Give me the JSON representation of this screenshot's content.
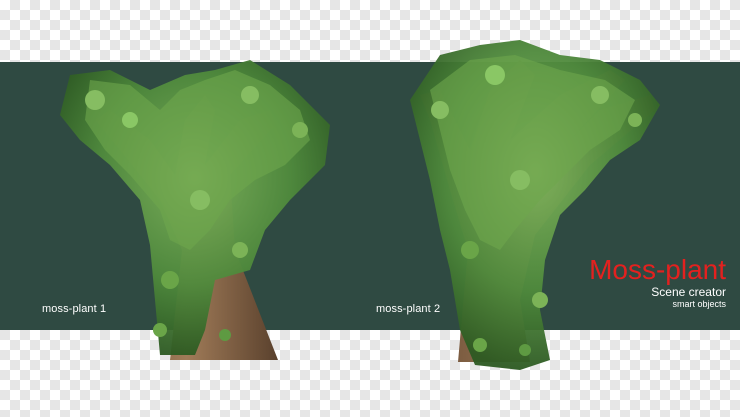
{
  "labels": {
    "plant_1": "moss-plant 1",
    "plant_2": "moss-plant 2"
  },
  "title_block": {
    "title": "Moss-plant",
    "subtitle": "Scene creator",
    "tagline": "smart objects"
  },
  "colors": {
    "band": "#2f4a42",
    "title": "#e3211f",
    "moss": "#4f8a3c",
    "bark": "#8a6a4a"
  }
}
